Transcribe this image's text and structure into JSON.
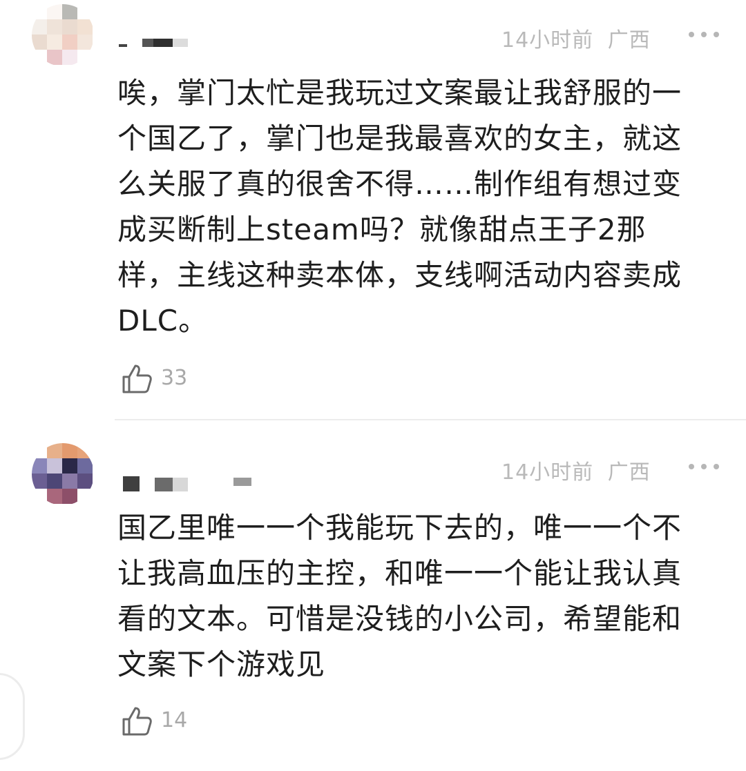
{
  "comments": [
    {
      "username": "",
      "time": "14小时前",
      "location": "广西",
      "text": "唉，掌门太忙是我玩过文案最让我舒服的一个国乙了，掌门也是我最喜欢的女主，就这么关服了真的很舍不得……制作组有想过变成买断制上steam吗？就像甜点王子2那样，主线这种卖本体，支线啊活动内容卖成DLC。",
      "likes": "33"
    },
    {
      "username": "",
      "time": "14小时前",
      "location": "广西",
      "text": "国乙里唯一一个我能玩下去的，唯一一个不让我高血压的主控，和唯一一个能让我认真看的文本。可惜是没钱的小公司，希望能和文案下个游戏见",
      "likes": "14"
    }
  ],
  "icons": {
    "like": "thumbs-up-icon",
    "more": "more-dots-icon",
    "avatar": "avatar-image"
  },
  "colors": {
    "meta": "#b9b9b9",
    "text": "#1e1e1e",
    "divider": "#ececec"
  }
}
